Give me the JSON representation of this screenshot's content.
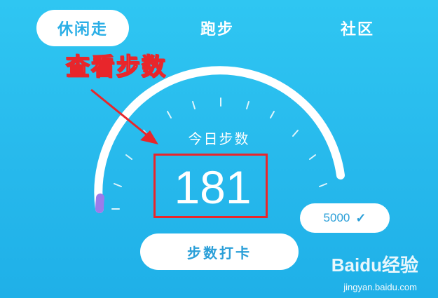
{
  "tabs": [
    {
      "label": "休闲走",
      "active": true
    },
    {
      "label": "跑步",
      "active": false
    },
    {
      "label": "社区",
      "active": false
    }
  ],
  "annotation": {
    "label": "查看步数"
  },
  "gauge": {
    "title": "今日步数",
    "steps": "181",
    "goal": "5000",
    "progress": 0.036,
    "colors": {
      "track": "#ffffff",
      "progress": "#9b7bea",
      "highlight": "#e8262b"
    }
  },
  "checkin": {
    "label": "步数打卡"
  },
  "watermark": {
    "brand": "Baidu经验",
    "url": "jingyan.baidu.com"
  },
  "icons": {
    "goal_check": "check-icon",
    "pointer": "arrow-icon"
  }
}
